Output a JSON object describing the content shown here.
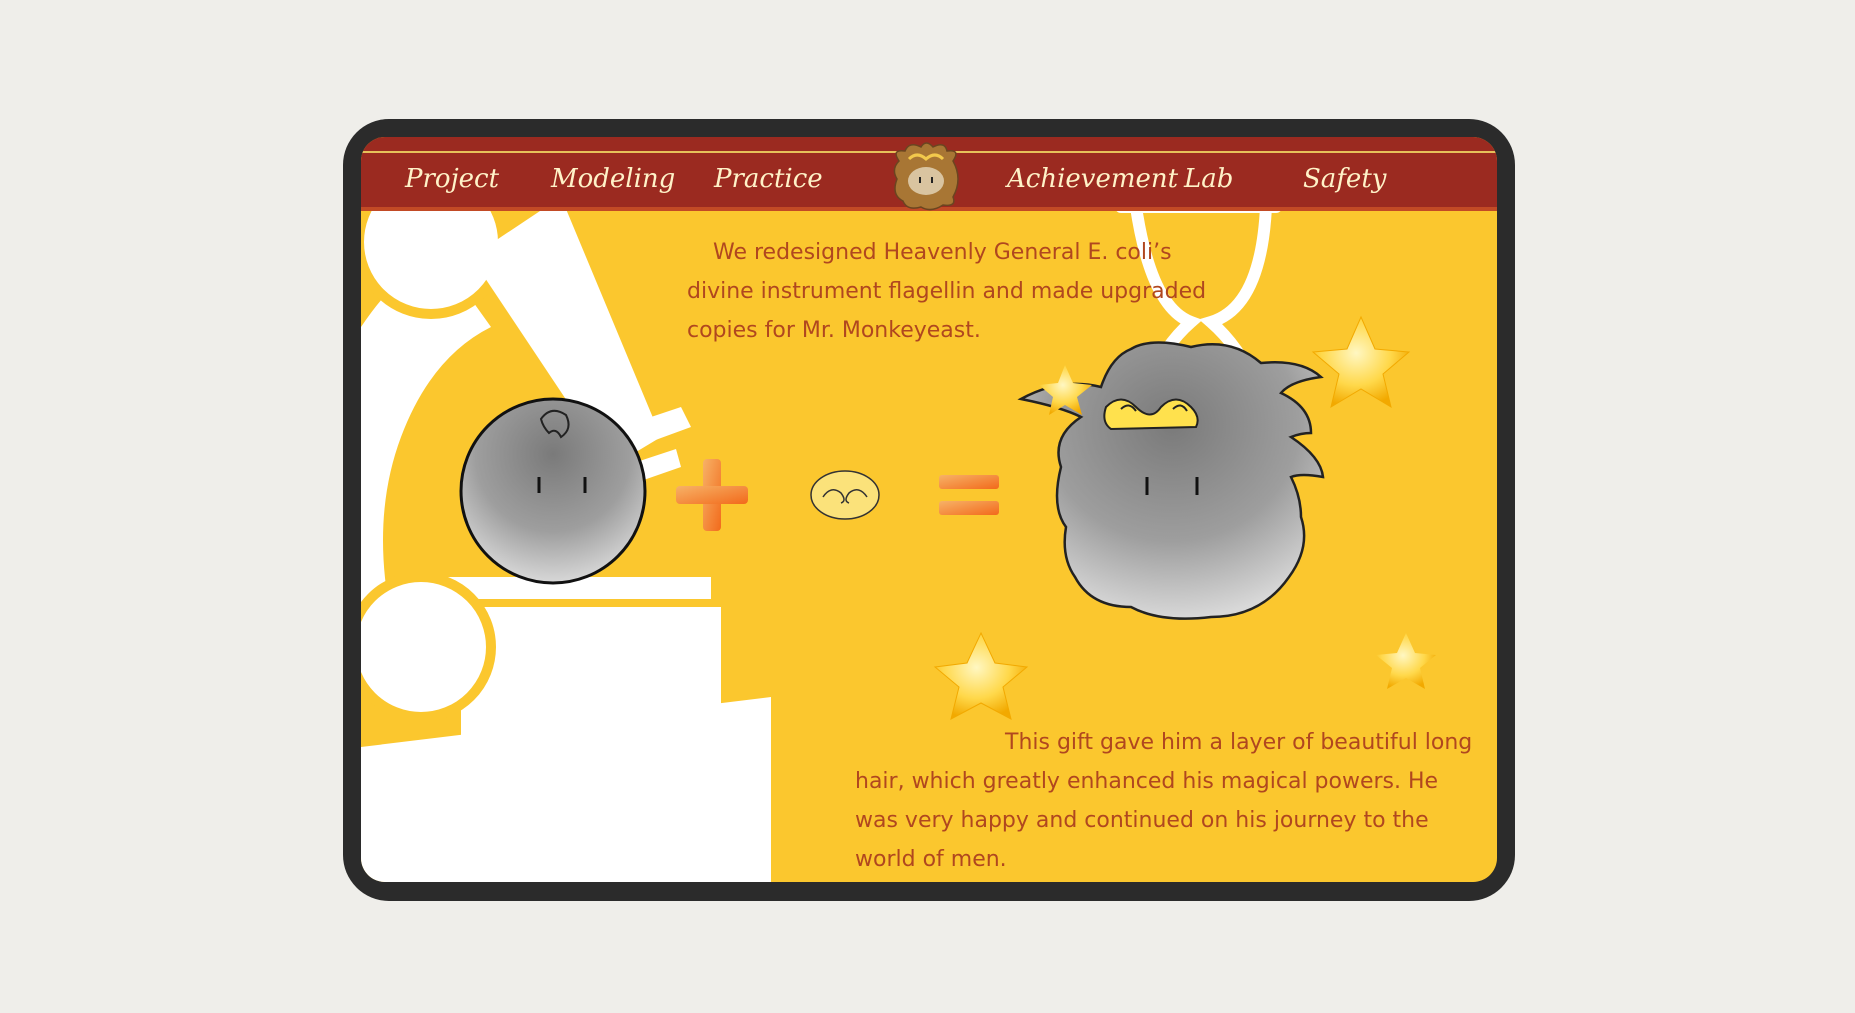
{
  "nav": {
    "items": [
      {
        "label": "Project"
      },
      {
        "label": "Modeling"
      },
      {
        "label": "Practice"
      },
      {
        "label": "Achievement"
      },
      {
        "label": "Lab"
      },
      {
        "label": "Safety"
      }
    ]
  },
  "content": {
    "intro": "We redesigned Heavenly General E. coli’s divine instrument flagellin and made upgraded copies for Mr. Monkeyeast.",
    "outro": "This gift gave him a layer of beautiful long hair, which greatly enhanced his magical powers. He was very happy and continued on his journey to the world of men."
  },
  "colors": {
    "nav_bg": "#9b2a20",
    "page_bg": "#fbc72e",
    "text": "#b0471f",
    "nav_text": "#fff2c8"
  }
}
